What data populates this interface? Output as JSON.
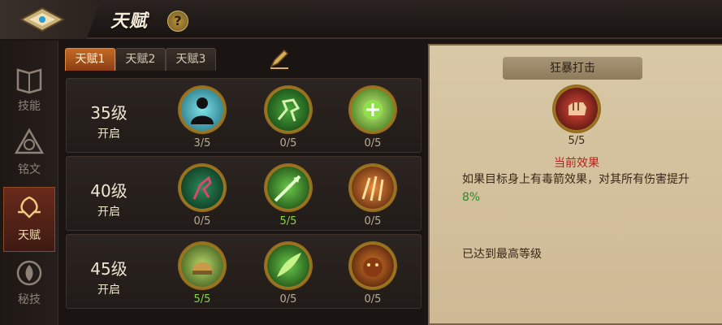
{
  "header": {
    "title": "天赋",
    "help": "?"
  },
  "nav": [
    {
      "label": "技能",
      "icon": "book-icon",
      "active": false
    },
    {
      "label": "铭文",
      "icon": "rune-icon",
      "active": false
    },
    {
      "label": "天赋",
      "icon": "talent-icon",
      "active": true
    },
    {
      "label": "秘技",
      "icon": "secret-skill-icon",
      "active": false
    }
  ],
  "tabs": [
    "天赋1",
    "天赋2",
    "天赋3"
  ],
  "active_tab": 0,
  "rows": [
    {
      "level": "35级",
      "unlock": "开启",
      "skills": [
        {
          "icon": "silhouette-icon",
          "points": "3/5",
          "full": false,
          "color": "#2aa8b8"
        },
        {
          "icon": "runner-icon",
          "points": "0/5",
          "full": false,
          "color": "#2e8a2a"
        },
        {
          "icon": "green-orb-icon",
          "points": "0/5",
          "full": false,
          "color": "#5ec42a"
        }
      ]
    },
    {
      "level": "40级",
      "unlock": "开启",
      "skills": [
        {
          "icon": "poison-hand-icon",
          "points": "0/5",
          "full": false,
          "color": "#1f6a3a"
        },
        {
          "icon": "arrow-strike-icon",
          "points": "5/5",
          "full": true,
          "color": "#3f8a2a"
        },
        {
          "icon": "claw-icon",
          "points": "0/5",
          "full": false,
          "color": "#c4681e"
        }
      ]
    },
    {
      "level": "45级",
      "unlock": "开启",
      "skills": [
        {
          "icon": "helmet-icon",
          "points": "5/5",
          "full": true,
          "color": "#7aa03a"
        },
        {
          "icon": "leaf-blade-icon",
          "points": "0/5",
          "full": false,
          "color": "#3c8a2a"
        },
        {
          "icon": "beast-icon",
          "points": "0/5",
          "full": false,
          "color": "#b8561e"
        }
      ]
    }
  ],
  "detail": {
    "name": "狂暴打击",
    "icon": "fist-icon",
    "points": "5/5",
    "effect_heading": "当前效果",
    "effect_text": "如果目标身上有毒箭效果，对其所有伤害提升",
    "effect_value": "8%",
    "max_level": "已达到最高等级"
  },
  "colors": {
    "accent": "#c66a24",
    "full": "#8ed04e",
    "effect": "#b7221a"
  }
}
